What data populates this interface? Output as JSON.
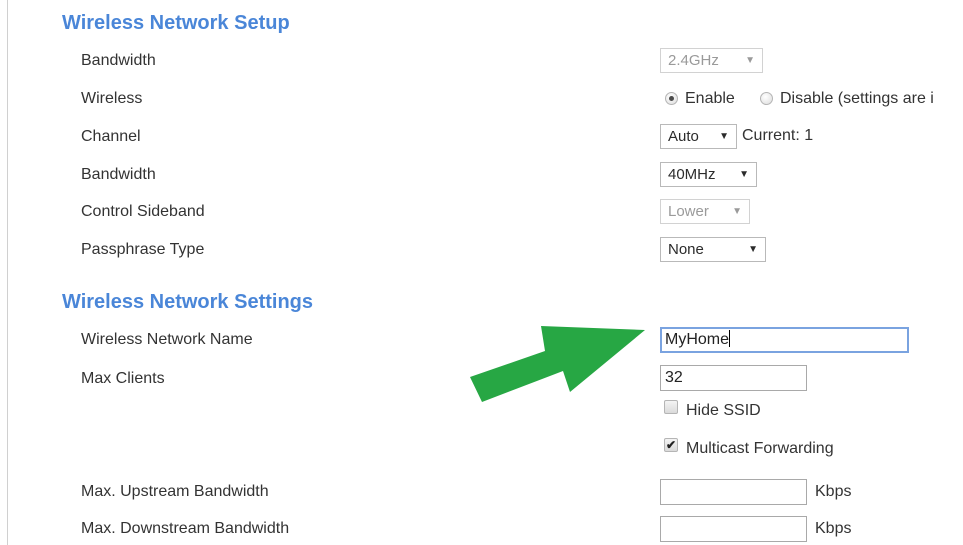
{
  "setup": {
    "title": "Wireless Network Setup",
    "bandwidth_band": {
      "label": "Bandwidth",
      "value": "2.4GHz",
      "disabled": true
    },
    "wireless": {
      "label": "Wireless",
      "enable_label": "Enable",
      "disable_label": "Disable (settings are i",
      "selected": "Enable"
    },
    "channel": {
      "label": "Channel",
      "value": "Auto",
      "current_text": "Current: 1"
    },
    "bandwidth_width": {
      "label": "Bandwidth",
      "value": "40MHz"
    },
    "control_sideband": {
      "label": "Control Sideband",
      "value": "Lower",
      "disabled": true
    },
    "passphrase_type": {
      "label": "Passphrase Type",
      "value": "None"
    }
  },
  "settings": {
    "title": "Wireless Network Settings",
    "network_name": {
      "label": "Wireless Network Name",
      "value": "MyHome"
    },
    "max_clients": {
      "label": "Max Clients",
      "value": "32"
    },
    "hide_ssid": {
      "label": "Hide SSID",
      "checked": false
    },
    "multicast": {
      "label": "Multicast Forwarding",
      "checked": true
    },
    "upstream": {
      "label": "Max. Upstream Bandwidth",
      "value": "",
      "unit": "Kbps"
    },
    "downstream": {
      "label": "Max. Downstream Bandwidth",
      "value": "",
      "unit": "Kbps"
    }
  },
  "icons": {
    "dropdown_arrow": "▼",
    "check_mark": "✔"
  },
  "colors": {
    "section_title": "#4a86d8",
    "arrow": "#27a744",
    "focus_border": "#7aa3e0"
  }
}
